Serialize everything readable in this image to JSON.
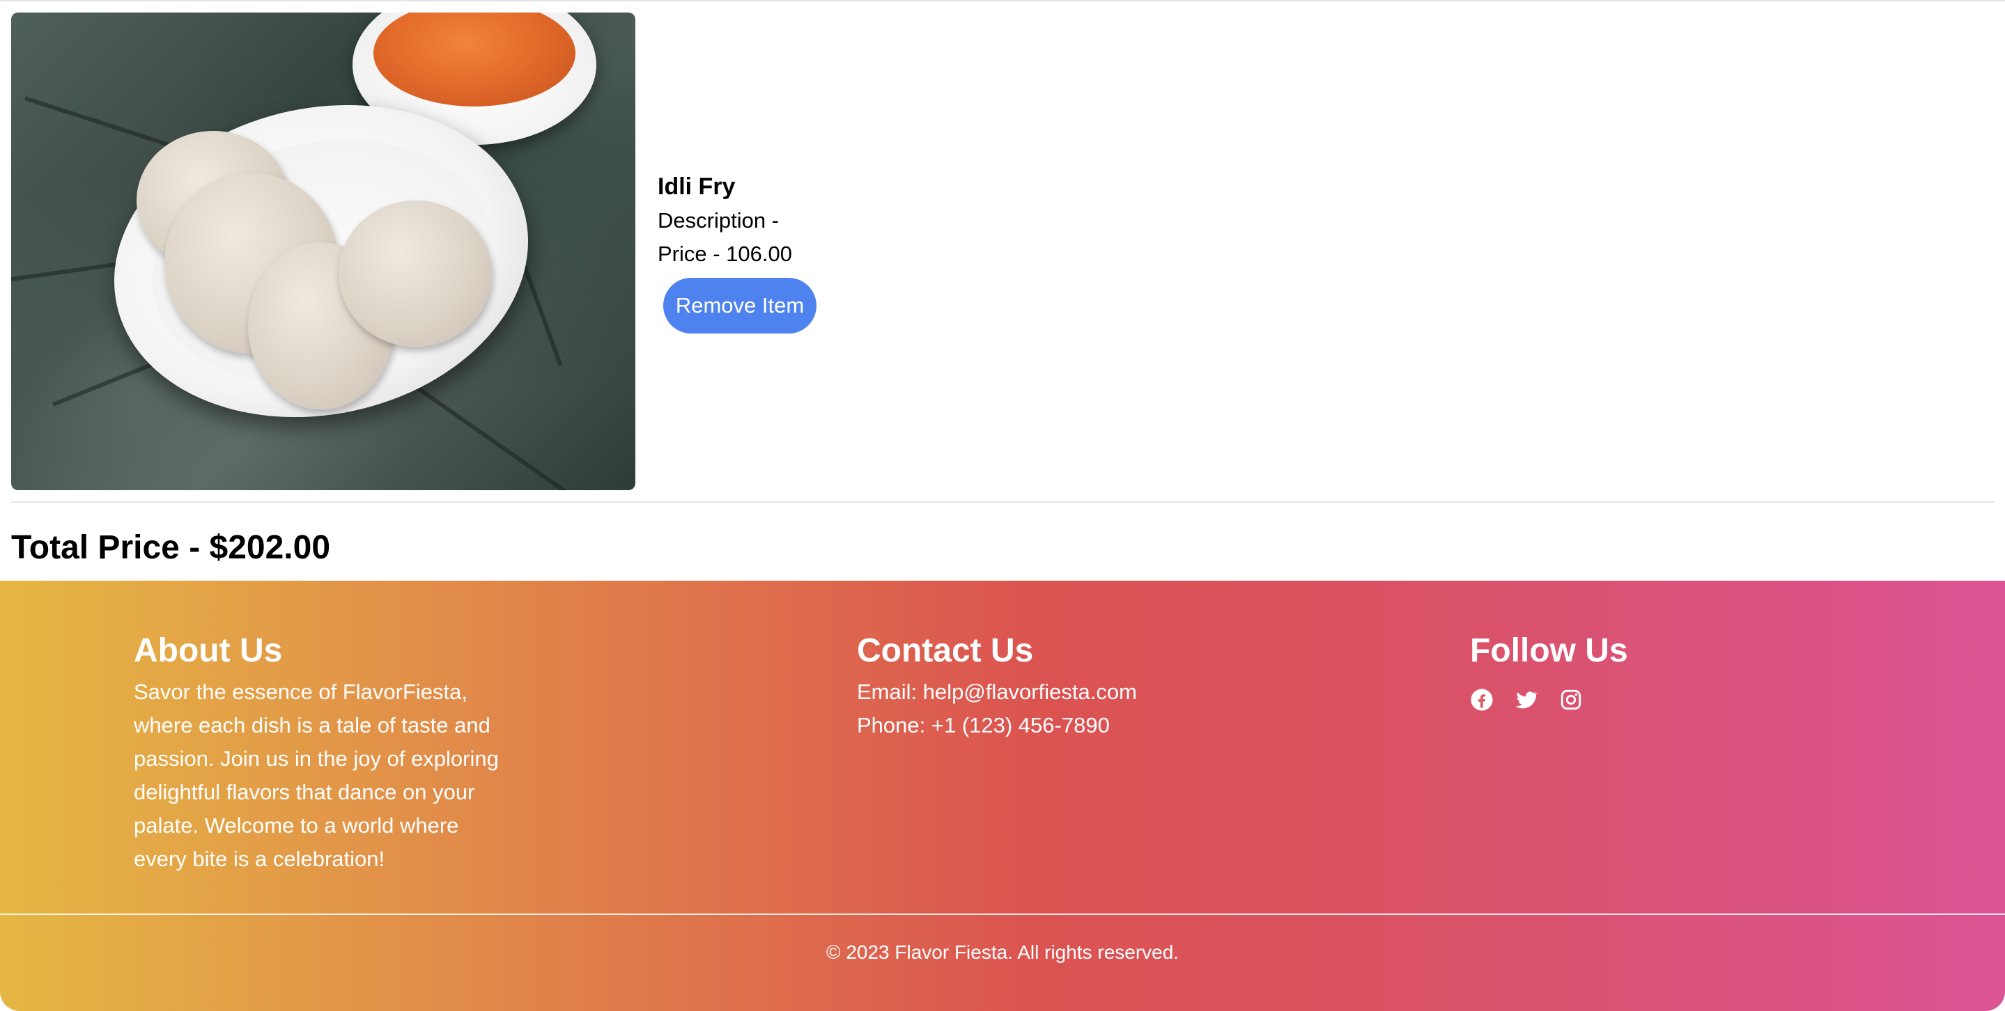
{
  "cart": {
    "items": [
      {
        "name": "Idli Fry",
        "description": "Description -",
        "price": "Price - 106.00",
        "remove_label": "Remove Item",
        "image_alt": "Idli with sambar"
      }
    ],
    "total": "Total Price - $202.00"
  },
  "footer": {
    "about": {
      "heading": "About Us",
      "lines": [
        "Savor the essence of FlavorFiesta,",
        "where each dish is a tale of taste and",
        "passion. Join us in the joy of exploring",
        "delightful flavors that dance on your",
        "palate. Welcome to a world where",
        "every bite is a celebration!"
      ]
    },
    "contact": {
      "heading": "Contact Us",
      "email": "Email: help@flavorfiesta.com",
      "phone": "Phone: +1 (123) 456-7890"
    },
    "follow": {
      "heading": "Follow Us",
      "icons": [
        "facebook-icon",
        "twitter-icon",
        "instagram-icon"
      ]
    },
    "copyright": "© 2023 Flavor Fiesta. All rights reserved."
  },
  "colors": {
    "button_bg": "#4e82ee",
    "footer_gradient": [
      "#e5b744",
      "#e0814a",
      "#db5350",
      "#da5266",
      "#dc5495"
    ],
    "footer_text": "#ffffff"
  }
}
